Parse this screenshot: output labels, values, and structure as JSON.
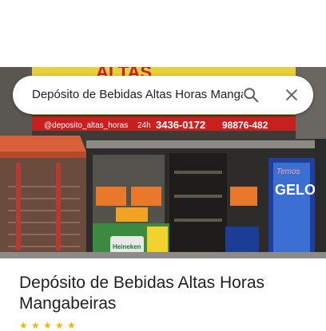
{
  "search": {
    "query": "Depósito de Bebidas Altas Horas Mangabeiras"
  },
  "photo": {
    "sign_instagram": "@deposito_altas_horas",
    "sign_hours": "24h",
    "sign_phone_1": "3436-0172",
    "sign_phone_2": "98876-482",
    "sign_brand": "Heineken",
    "fridge_text_1": "Temos",
    "fridge_text_2": "GELO",
    "sign_top": "ALTAS"
  },
  "place": {
    "title": "Depósito de Bebidas Altas Horas Mangabeiras"
  },
  "colors": {
    "accent_yellow": "#f2d22e",
    "sign_red": "#c8201e",
    "fridge_blue": "#1f3f9a",
    "star": "#f6b400"
  },
  "icons": {
    "search": "search-icon",
    "close": "close-icon"
  }
}
